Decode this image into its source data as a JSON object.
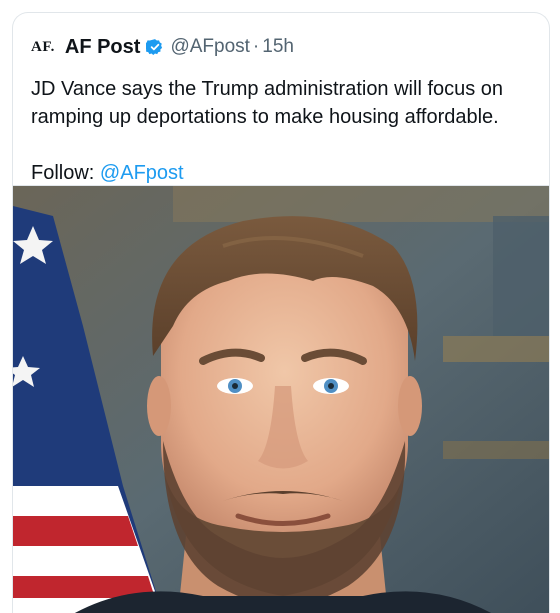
{
  "post": {
    "logo_text": "AF.",
    "author_name": "AF Post",
    "verified_icon": "verified-badge-icon",
    "handle": "@AFpost",
    "separator": "·",
    "time": "15h",
    "body": "JD Vance says the Trump administration will focus on ramping up deportations to make housing affordable.",
    "follow_label": "Follow:",
    "follow_handle": "@AFpost"
  },
  "colors": {
    "text": "#0f1419",
    "muted": "#536471",
    "link": "#1d9bf0",
    "verified": "#1d9bf0"
  }
}
